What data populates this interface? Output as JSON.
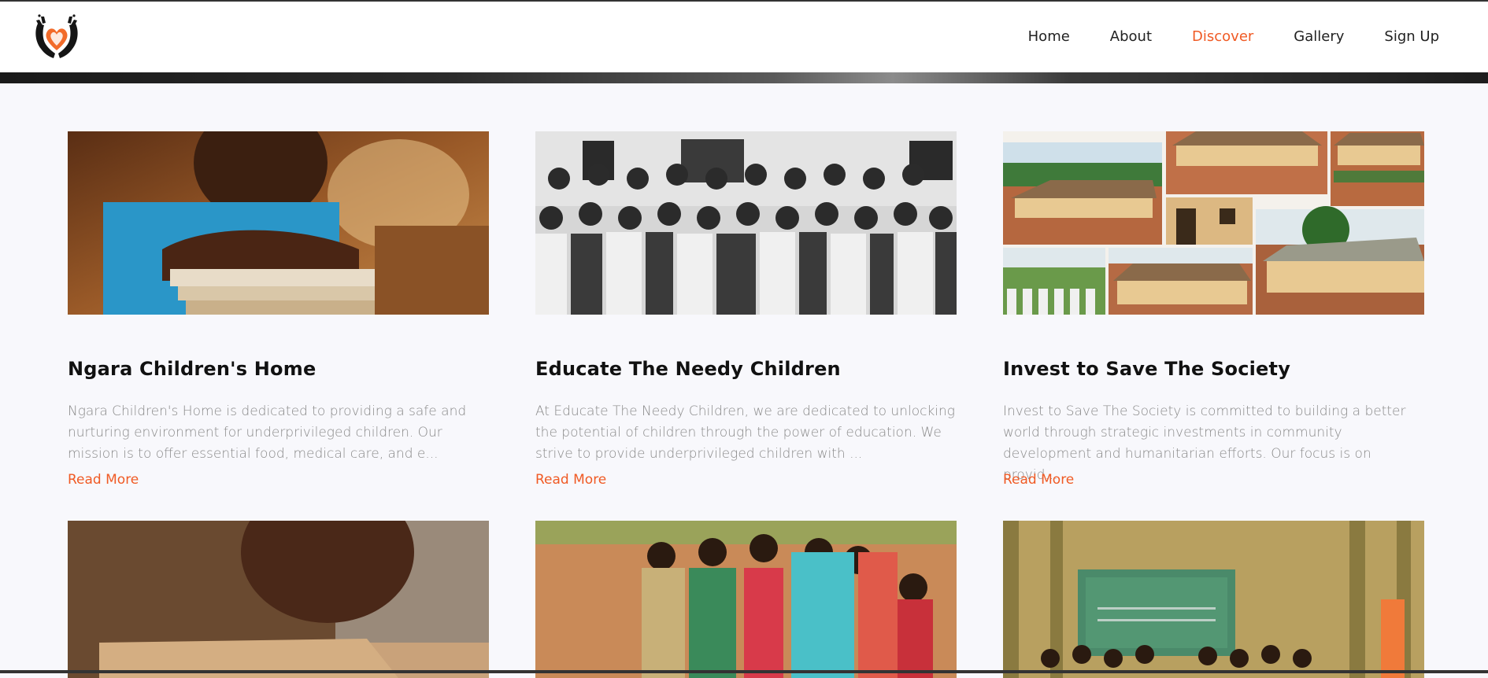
{
  "nav": {
    "items": [
      {
        "label": "Home",
        "active": false
      },
      {
        "label": "About",
        "active": false
      },
      {
        "label": "Discover",
        "active": true
      },
      {
        "label": "Gallery",
        "active": false
      },
      {
        "label": "Sign Up",
        "active": false
      }
    ]
  },
  "colors": {
    "accent": "#f05a24",
    "background": "#f8f8fc",
    "title": "#111111",
    "description": "#8a8a8a"
  },
  "logo": {
    "icon": "hands-holding-heart-icon"
  },
  "cards": [
    {
      "title": "Ngara Children's Home",
      "description": "Ngara Children's Home is dedicated to providing a safe and nurturing environment for underprivileged children. Our mission is to offer essential food, medical care, and e...",
      "link": "Read More"
    },
    {
      "title": "Educate The Needy Children",
      "description": "At Educate The Needy Children, we are dedicated to unlocking the potential of children through the power of education. We strive to provide underprivileged children with ...",
      "link": "Read More"
    },
    {
      "title": "Invest to Save The Society",
      "description": "Invest to Save The Society is committed to building a better world through strategic investments in community development and humanitarian efforts. Our focus is on provid...",
      "link": "Read More"
    }
  ]
}
